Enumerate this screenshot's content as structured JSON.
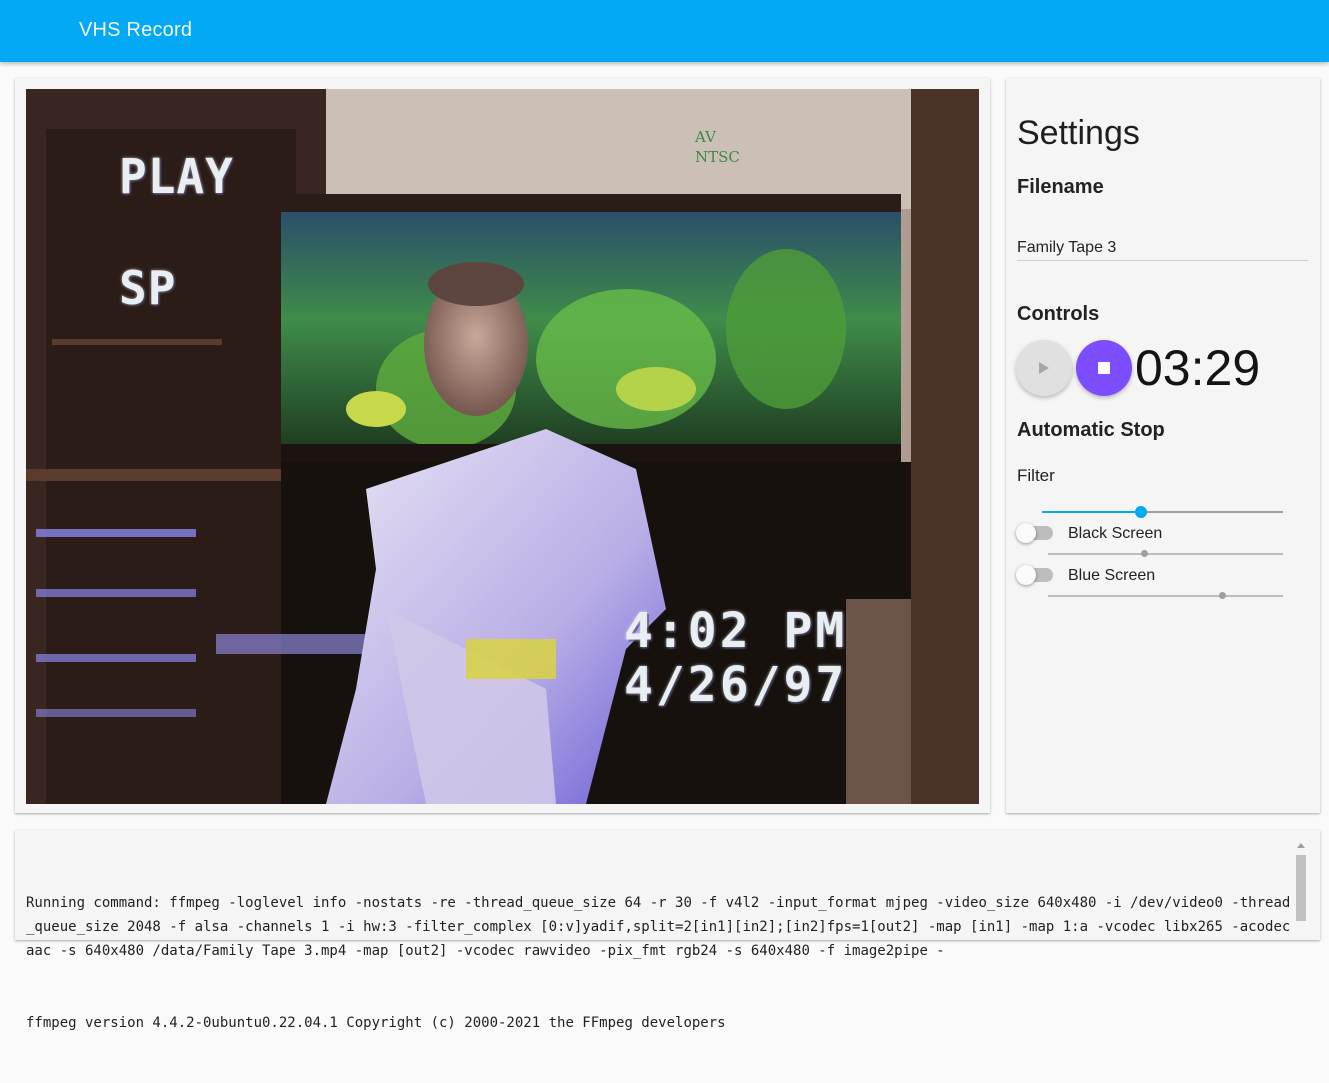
{
  "app": {
    "title": "VHS Record"
  },
  "video": {
    "osd_mode": "PLAY",
    "osd_speed": "SP",
    "osd_input_line1": "AV",
    "osd_input_line2": "NTSC",
    "osd_time": "4:02 PM",
    "osd_date": "4/26/97"
  },
  "settings": {
    "title": "Settings",
    "filename_heading": "Filename",
    "filename_value": "Family Tape 3",
    "controls_heading": "Controls",
    "play_icon": "play-icon",
    "stop_icon": "stop-icon",
    "timer": "03:29",
    "auto_stop_heading": "Automatic Stop",
    "filter_label": "Filter",
    "filter_slider_value": 0.41,
    "black_screen": {
      "label": "Black Screen",
      "enabled": false,
      "slider_value": 0.41
    },
    "blue_screen": {
      "label": "Blue Screen",
      "enabled": false,
      "slider_value": 0.74
    }
  },
  "log": {
    "lines": [
      "Running command: ffmpeg -loglevel info -nostats -re -thread_queue_size 64 -r 30 -f v4l2 -input_format mjpeg -video_size 640x480 -i /dev/video0 -thread_queue_size 2048 -f alsa -channels 1 -i hw:3 -filter_complex [0:v]yadif,split=2[in1][in2];[in2]fps=1[out2] -map [in1] -map 1:a -vcodec libx265 -acodec aac -s 640x480 /data/Family Tape 3.mp4 -map [out2] -vcodec rawvideo -pix_fmt rgb24 -s 640x480 -f image2pipe -",
      "ffmpeg version 4.4.2-0ubuntu0.22.04.1 Copyright (c) 2000-2021 the FFmpeg developers"
    ]
  },
  "colors": {
    "appbar": "#03a9f4",
    "stop_button": "#7c4dff",
    "play_button_disabled": "#e0e0e0",
    "slider_active": "#03a9f4"
  }
}
